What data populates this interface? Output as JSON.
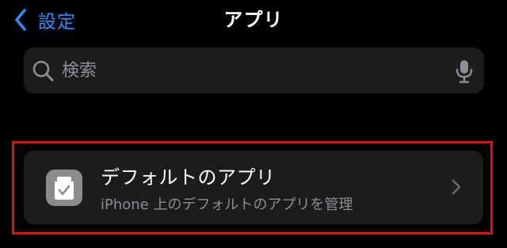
{
  "nav": {
    "back_label": "設定",
    "title": "アプリ"
  },
  "search": {
    "placeholder": "検索",
    "icon": "search-icon",
    "mic_icon": "mic-icon"
  },
  "row": {
    "title": "デフォルトのアプリ",
    "subtitle": "iPhone 上のデフォルトのアプリを管理",
    "icon": "default-apps-icon",
    "highlight_color": "#e01010"
  },
  "colors": {
    "background": "#000000",
    "cell": "#1c1c1e",
    "accent": "#2f8cff",
    "secondary_text": "#8e8e93"
  }
}
